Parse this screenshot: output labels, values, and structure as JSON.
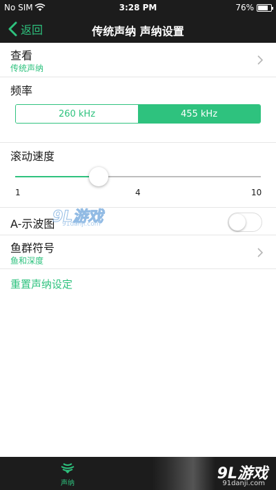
{
  "status_bar": {
    "carrier": "No SIM",
    "time": "3:28 PM",
    "battery_percent": "76%",
    "battery_level": 0.76,
    "icons": [
      "wifi-icon",
      "battery-icon"
    ]
  },
  "nav": {
    "back_label": "返回",
    "title": "传统声纳 声纳设置"
  },
  "view": {
    "title": "查看",
    "value": "传统声纳"
  },
  "frequency": {
    "title": "频率",
    "options": [
      "260 kHz",
      "455 kHz"
    ],
    "selected": "455 kHz"
  },
  "scroll_speed": {
    "title": "滚动速度",
    "min_label": "1",
    "mid_label": "4",
    "max_label": "10",
    "value": 4
  },
  "a_scope": {
    "title": "A-示波图",
    "enabled": false
  },
  "fish_symbol": {
    "title": "鱼群符号",
    "value": "鱼和深度"
  },
  "reset": {
    "label": "重置声纳设定"
  },
  "tab_bar": {
    "items": [
      {
        "label": "声纳",
        "icon": "sonar-icon",
        "selected": true
      }
    ]
  },
  "watermark": {
    "logo": "9L游戏",
    "url": "91danji.com"
  },
  "colors": {
    "accent": "#2ec27e",
    "bar_background": "#1c1c1c",
    "divider": "#e6e6e6"
  }
}
